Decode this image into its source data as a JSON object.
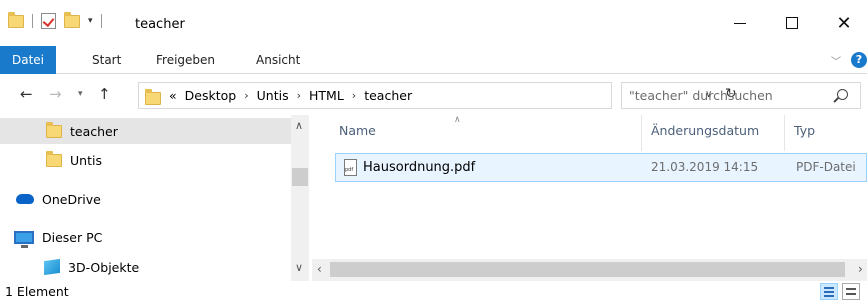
{
  "window": {
    "title": "teacher",
    "minimize_glyph": "",
    "close_glyph": "✕"
  },
  "ribbon": {
    "tabs": [
      {
        "label": "Datei",
        "active": true
      },
      {
        "label": "Start"
      },
      {
        "label": "Freigeben"
      },
      {
        "label": "Ansicht"
      }
    ],
    "help_label": "?"
  },
  "address": {
    "prefix": "«",
    "crumbs": [
      "Desktop",
      "Untis",
      "HTML",
      "teacher"
    ]
  },
  "search": {
    "placeholder": "\"teacher\" durchsuchen"
  },
  "nav_pane": {
    "items": [
      {
        "label": "teacher",
        "icon": "folder-icon",
        "selected": true
      },
      {
        "label": "Untis",
        "icon": "folder-icon"
      },
      {
        "label": "OneDrive",
        "icon": "onedrive-icon"
      },
      {
        "label": "Dieser PC",
        "icon": "pc-icon"
      },
      {
        "label": "3D-Objekte",
        "icon": "cube-icon"
      }
    ]
  },
  "columns": {
    "name": "Name",
    "date": "Änderungsdatum",
    "type": "Typ"
  },
  "files": [
    {
      "name": "Hausordnung.pdf",
      "date": "21.03.2019 14:15",
      "type": "PDF-Datei",
      "icon": "pdf-file-icon"
    }
  ],
  "status": {
    "text": "1 Element"
  },
  "colors": {
    "accent": "#1979ca",
    "folder": "#f8d775",
    "selection": "#e5e5e5"
  }
}
